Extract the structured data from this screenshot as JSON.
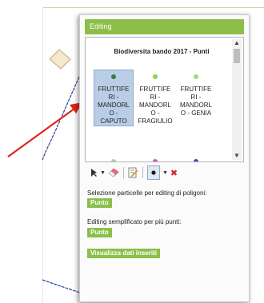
{
  "panel": {
    "title": "Editing",
    "layer_title": "Biodiversita bando 2017 - Punti",
    "symbols": [
      {
        "label": "FRUTTIFE\nRI -\nMANDORL\nO -\nCAPUTO",
        "color": "#3d7a3d",
        "selected": true
      },
      {
        "label": "FRUTTIFE\nRI -\nMANDORL\nO -\nFRAGIULIO",
        "color": "#7ed957",
        "selected": false
      },
      {
        "label": "FRUTTIFE\nRI -\nMANDORL\nO - GENIA",
        "color": "#8fe07a",
        "selected": false
      }
    ],
    "next_row_colors": [
      "#a8d98a",
      "#d44fc8",
      "#2b4fa8"
    ]
  },
  "toolbar": {
    "icons": [
      "select-arrow-icon",
      "dropdown-icon",
      "eraser-icon",
      "edit-attributes-icon",
      "point-draw-icon",
      "dropdown-icon",
      "delete-icon"
    ]
  },
  "sections": {
    "polygon_label": "Selezione particelle per editing di poligoni:",
    "polygon_button": "Punto",
    "multi_label": "Editing semplificato per più punti:",
    "multi_button": "Punto",
    "view_button": "Visualizza dati inseriti"
  },
  "colors": {
    "accent": "#8cbf4a",
    "selection": "#b9cde6",
    "arrow": "#e0241b"
  }
}
